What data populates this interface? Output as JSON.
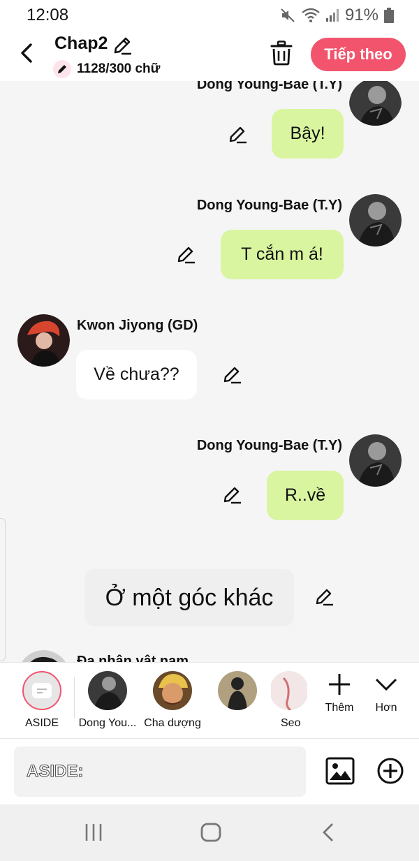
{
  "status_bar": {
    "time": "12:08",
    "battery": "91%"
  },
  "header": {
    "title": "Chap2",
    "word_count": "1128/300 chữ",
    "next_label": "Tiếp theo"
  },
  "messages": [
    {
      "speaker": "Dong Young-Bae (T.Y)",
      "text": "Bậy!",
      "side": "right"
    },
    {
      "speaker": "Dong Young-Bae (T.Y)",
      "text": "T cắn m á!",
      "side": "right"
    },
    {
      "speaker": "Kwon Jiyong (GD)",
      "text": "Về chưa??",
      "side": "left"
    },
    {
      "speaker": "Dong Young-Bae (T.Y)",
      "text": "R..về",
      "side": "right"
    },
    {
      "speaker": "",
      "text": "Ở một góc khác",
      "side": "aside"
    },
    {
      "speaker": "Đa nhân vật nam",
      "text": "",
      "side": "left"
    }
  ],
  "characters": [
    {
      "label": "ASIDE"
    },
    {
      "label": "Dong You..."
    },
    {
      "label": "Cha dượng"
    },
    {
      "label": ""
    },
    {
      "label": "Seo"
    }
  ],
  "bar_buttons": {
    "add_label": "Thêm",
    "more_label": "Hơn"
  },
  "input": {
    "placeholder": "ASIDE:"
  },
  "colors": {
    "accent": "#f2546d",
    "bubble_green": "#d9f5a0",
    "bubble_white": "#ffffff"
  }
}
